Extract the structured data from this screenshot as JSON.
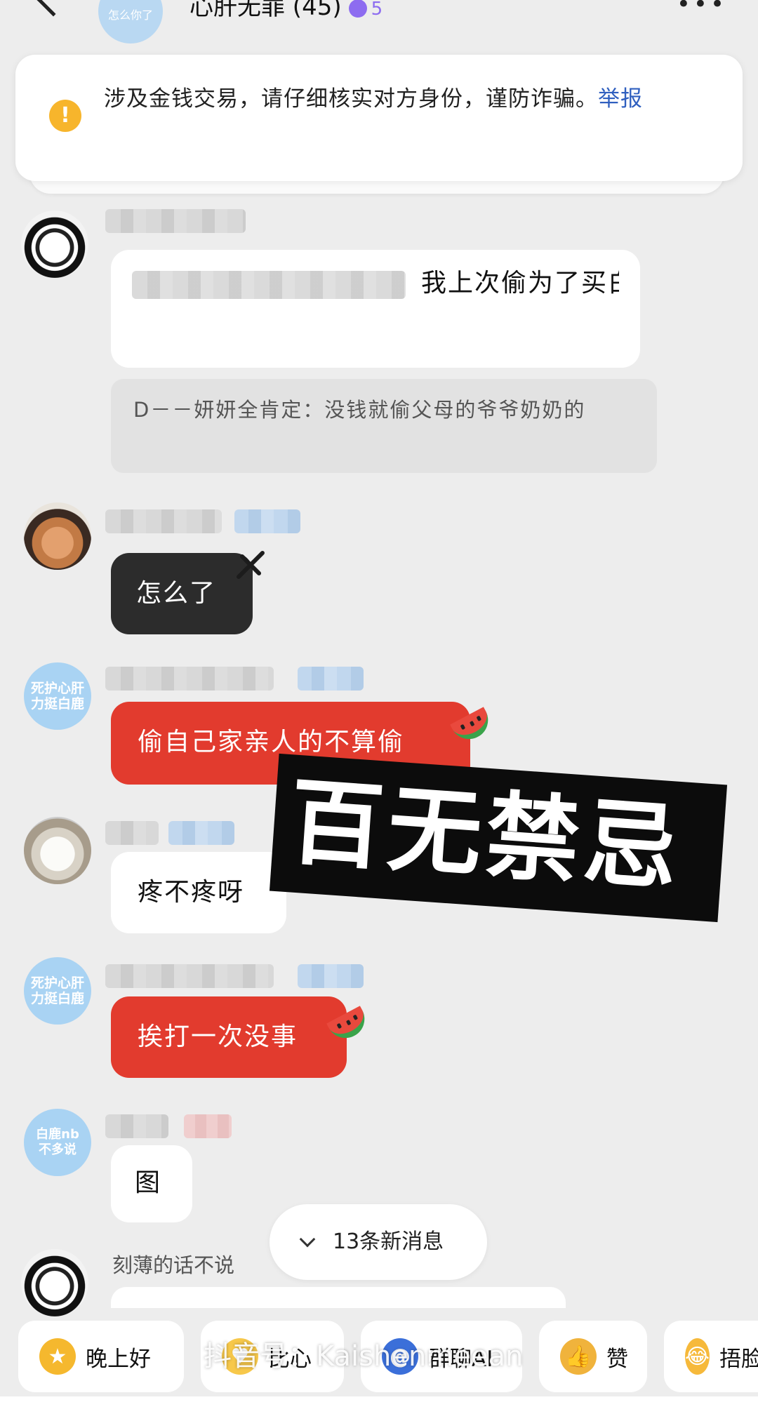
{
  "header": {
    "avatar_label": "怎么你了",
    "title": "心肝无罪 (45)",
    "badge_count": "5",
    "more_label": "•••"
  },
  "warning": {
    "text": "涉及金钱交易，请仔细核实对方身份，谨防诈骗。",
    "report_link": "举报"
  },
  "messages": [
    {
      "text": "我上次偷为了买白鹿代言被发现给我打了一顿😭",
      "quote": "D－－妍妍全肯定：没钱就偷父母的爷爷奶奶的"
    },
    {
      "text": "怎么了"
    },
    {
      "avatar_text": "死护心肝力挺白鹿",
      "text": "偷自己家亲人的不算偷"
    },
    {
      "text": "疼不疼呀"
    },
    {
      "avatar_text": "死护心肝力挺白鹿",
      "text": "挨打一次没事"
    },
    {
      "avatar_text": "白鹿nb不多说",
      "text": "图"
    },
    {
      "sender_caption": "刻薄的话不说"
    }
  ],
  "overlay": {
    "text": "百无禁忌"
  },
  "new_messages": {
    "label": "13条新消息"
  },
  "quick_replies": [
    {
      "label": "晚上好",
      "icon": "star-face-icon",
      "color": "#f5b82e"
    },
    {
      "label": "比心",
      "icon": "heart-hands-icon",
      "color": "#f7c84a"
    },
    {
      "label": "群聊AI",
      "icon": "at-sign-icon",
      "color": "#3b6fd9"
    },
    {
      "label": "赞",
      "icon": "thumbs-up-icon",
      "color": "#f0b33c"
    },
    {
      "label": "捂脸",
      "icon": "laugh-cry-icon",
      "color": "#f6b93b"
    }
  ],
  "watermark": "抖音号：Kaishenmeean",
  "colors": {
    "red_bubble": "#e23b2e",
    "dark_bubble": "#2c2c2c",
    "warning_icon": "#f7b52c",
    "link": "#2f5fbf"
  }
}
